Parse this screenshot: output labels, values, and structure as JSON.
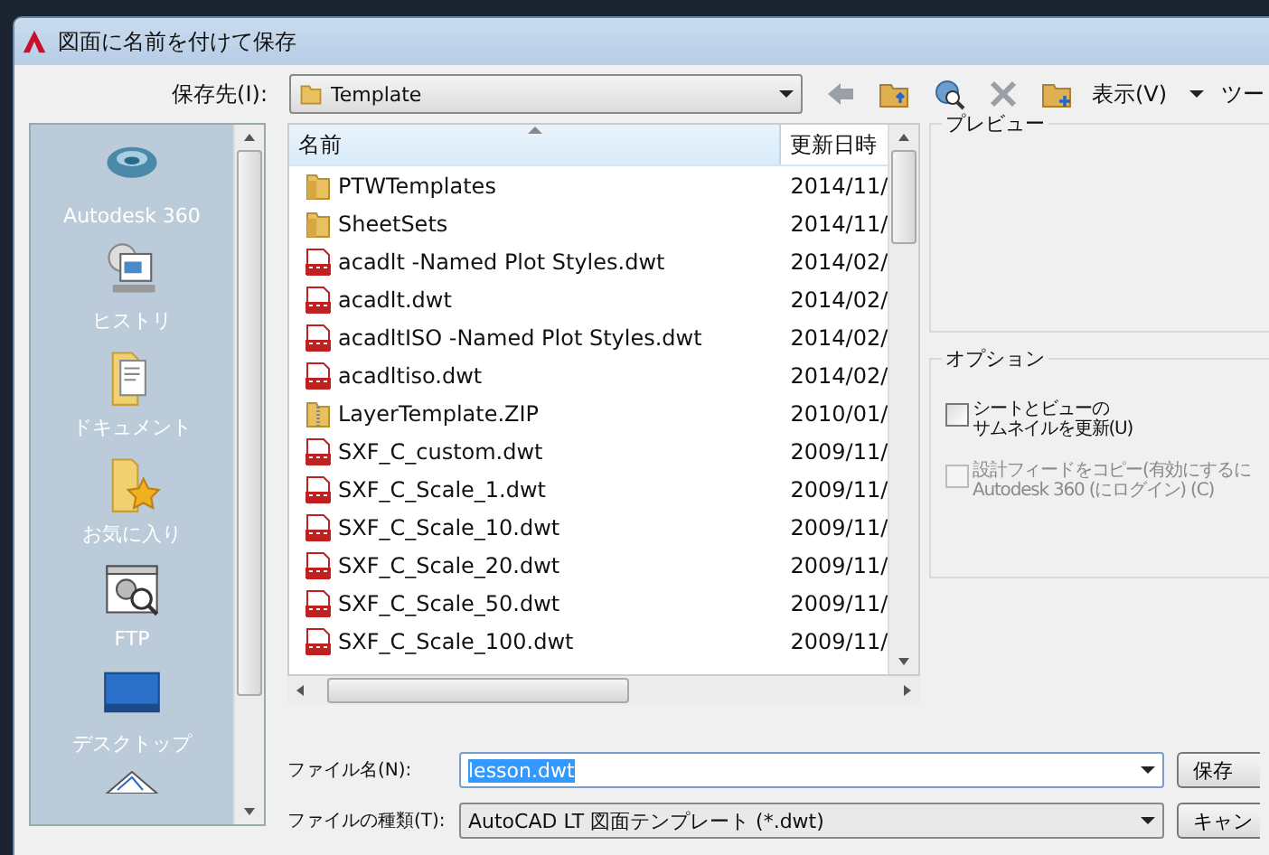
{
  "window": {
    "title": "図面に名前を付けて保存"
  },
  "toolbar": {
    "location_label": "保存先(I):",
    "location": "Template",
    "view_menu": "表示(V)",
    "tools_menu": "ツー"
  },
  "sidebar": {
    "items": [
      {
        "label": "Autodesk 360",
        "kind": "cloud"
      },
      {
        "label": "ヒストリ",
        "kind": "history"
      },
      {
        "label": "ドキュメント",
        "kind": "documents"
      },
      {
        "label": "お気に入り",
        "kind": "favorites"
      },
      {
        "label": "FTP",
        "kind": "ftp"
      },
      {
        "label": "デスクトップ",
        "kind": "desktop"
      }
    ]
  },
  "file_list": {
    "columns": [
      "名前",
      "更新日時"
    ],
    "rows": [
      {
        "name": "PTWTemplates",
        "date": "2014/11/",
        "kind": "folder"
      },
      {
        "name": "SheetSets",
        "date": "2014/11/",
        "kind": "folder"
      },
      {
        "name": "acadlt -Named Plot Styles.dwt",
        "date": "2014/02/",
        "kind": "dwt"
      },
      {
        "name": "acadlt.dwt",
        "date": "2014/02/",
        "kind": "dwt"
      },
      {
        "name": "acadltISO -Named Plot Styles.dwt",
        "date": "2014/02/",
        "kind": "dwt"
      },
      {
        "name": "acadltiso.dwt",
        "date": "2014/02/",
        "kind": "dwt"
      },
      {
        "name": "LayerTemplate.ZIP",
        "date": "2010/01/",
        "kind": "zip"
      },
      {
        "name": "SXF_C_custom.dwt",
        "date": "2009/11/",
        "kind": "dwt"
      },
      {
        "name": "SXF_C_Scale_1.dwt",
        "date": "2009/11/",
        "kind": "dwt"
      },
      {
        "name": "SXF_C_Scale_10.dwt",
        "date": "2009/11/",
        "kind": "dwt"
      },
      {
        "name": "SXF_C_Scale_20.dwt",
        "date": "2009/11/",
        "kind": "dwt"
      },
      {
        "name": "SXF_C_Scale_50.dwt",
        "date": "2009/11/",
        "kind": "dwt"
      },
      {
        "name": "SXF_C_Scale_100.dwt",
        "date": "2009/11/",
        "kind": "dwt"
      }
    ]
  },
  "preview": {
    "title": "プレビュー"
  },
  "options": {
    "title": "オプション",
    "checkboxes": [
      {
        "lines": [
          "シートとビューの",
          "サムネイルを更新(U)"
        ],
        "checked": false,
        "disabled": false
      },
      {
        "lines": [
          "設計フィードをコピー(有効にするに",
          "Autodesk 360 (にログイン) (C)"
        ],
        "checked": false,
        "disabled": true
      }
    ]
  },
  "filename": {
    "label": "ファイル名(N):",
    "value": "lesson.dwt",
    "selected": true
  },
  "filetype": {
    "label": "ファイルの種類(T):",
    "value": "AutoCAD LT 図面テンプレート (*.dwt)"
  },
  "buttons": [
    "保存",
    "キャン"
  ]
}
